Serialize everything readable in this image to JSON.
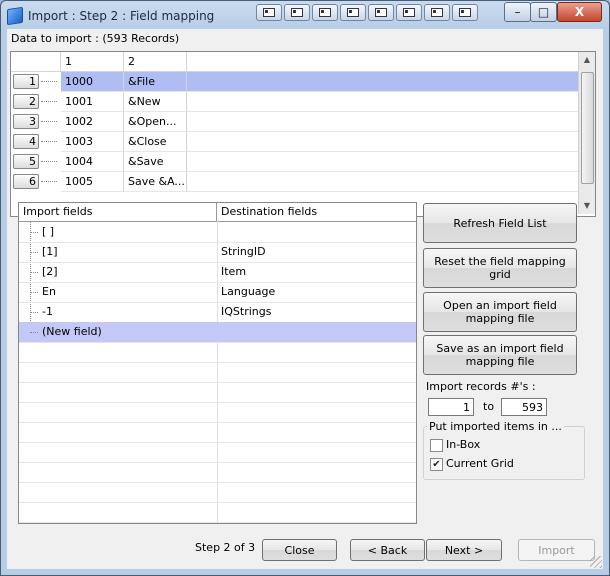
{
  "window": {
    "title": "Import : Step 2 : Field mapping",
    "controls": {
      "minimize": "–",
      "maximize": "□",
      "close": "X"
    }
  },
  "data_to_import_label": "Data to import : (593 Records)",
  "data_grid": {
    "headers": [
      "1",
      "2"
    ],
    "rows": [
      {
        "num": "1",
        "c1": "1000",
        "c2": "&File"
      },
      {
        "num": "2",
        "c1": "1001",
        "c2": "&New"
      },
      {
        "num": "3",
        "c1": "1002",
        "c2": "&Open..."
      },
      {
        "num": "4",
        "c1": "1003",
        "c2": "&Close"
      },
      {
        "num": "5",
        "c1": "1004",
        "c2": "&Save"
      },
      {
        "num": "6",
        "c1": "1005",
        "c2": "Save &A..."
      }
    ],
    "selected_row": 0
  },
  "mapping_grid": {
    "headers": [
      "Import fields",
      "Destination fields"
    ],
    "rows": [
      {
        "import": "[ ]",
        "dest": ""
      },
      {
        "import": "[1]",
        "dest": "StringID"
      },
      {
        "import": "[2]",
        "dest": "Item"
      },
      {
        "import": "En",
        "dest": "Language"
      },
      {
        "import": "-1",
        "dest": "IQStrings"
      },
      {
        "import": "(New field)",
        "dest": ""
      }
    ],
    "selected_row": 5
  },
  "buttons": {
    "refresh": "Refresh Field List",
    "reset": "Reset the field mapping grid",
    "open": "Open an import field mapping file",
    "save": "Save as an import field mapping file"
  },
  "import_records": {
    "label": "Import records #'s :",
    "from": "1",
    "to_label": "to",
    "to": "593"
  },
  "put_items": {
    "label": "Put imported items in ...",
    "options": [
      {
        "label": "In-Box",
        "checked": false
      },
      {
        "label": "Current Grid",
        "checked": true
      }
    ]
  },
  "footer": {
    "step": "Step 2 of 3",
    "close": "Close",
    "back": "< Back",
    "next": "Next >",
    "import": "Import"
  }
}
